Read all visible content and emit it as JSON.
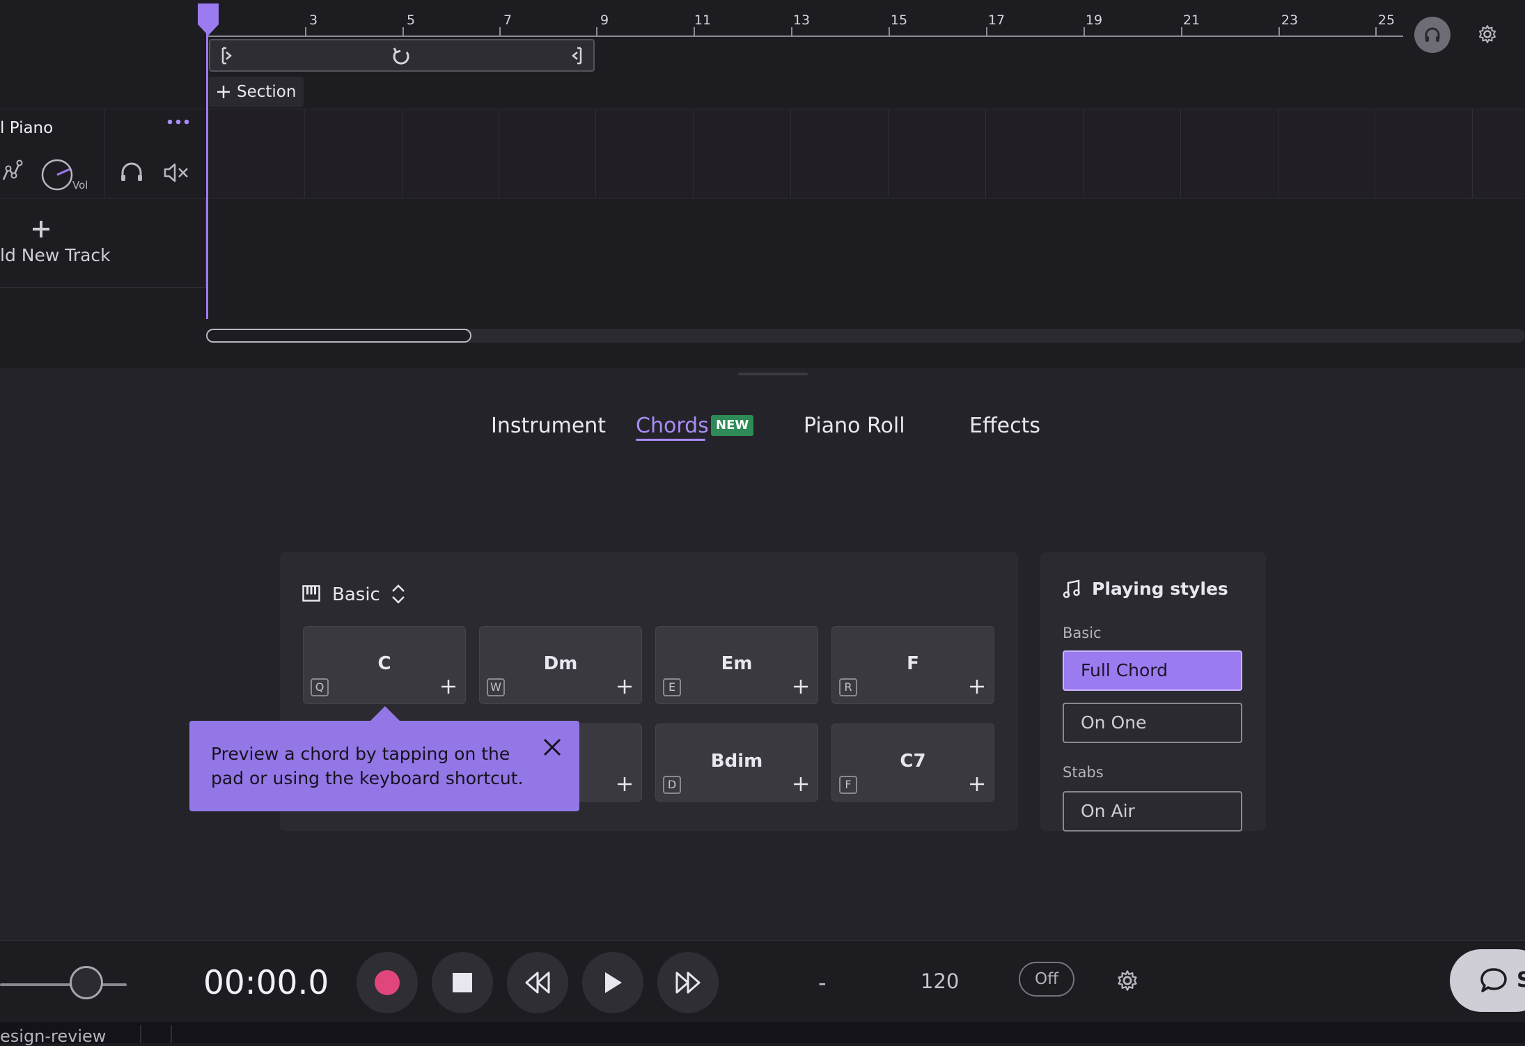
{
  "ruler": {
    "ticks": [
      "3",
      "5",
      "7",
      "9",
      "11",
      "13",
      "15",
      "17",
      "19",
      "21",
      "23",
      "25"
    ]
  },
  "timeline": {
    "section_button": "Section"
  },
  "track": {
    "name": "l Piano",
    "vol_label": "Vol",
    "add_track_label": "ld New Track"
  },
  "tabs": {
    "instrument": "Instrument",
    "chords": "Chords",
    "chords_badge": "NEW",
    "piano_roll": "Piano Roll",
    "effects": "Effects",
    "active": "Chords"
  },
  "chords_panel": {
    "set_name": "Basic",
    "pads": [
      {
        "name": "C",
        "key": "Q"
      },
      {
        "name": "Dm",
        "key": "W"
      },
      {
        "name": "Em",
        "key": "E"
      },
      {
        "name": "F",
        "key": "R"
      },
      {
        "name": "Bdim",
        "key": "D"
      },
      {
        "name": "C7",
        "key": "F"
      }
    ],
    "tooltip": "Preview a chord by tapping on the pad or using the keyboard shortcut."
  },
  "playing_styles": {
    "title": "Playing styles",
    "basic_label": "Basic",
    "basic_options": [
      "Full Chord",
      "On One"
    ],
    "selected": "Full Chord",
    "stabs_label": "Stabs",
    "stabs_options": [
      "On Air"
    ]
  },
  "transport": {
    "time": "00:00.0",
    "time_signature": "-",
    "tempo": "120",
    "metronome": "Off",
    "chat_label": "S"
  },
  "bottom_bar": {
    "label": "esign-review"
  },
  "colors": {
    "accent": "#9b7bf0",
    "record": "#e0457b",
    "badge": "#2e8b57"
  }
}
